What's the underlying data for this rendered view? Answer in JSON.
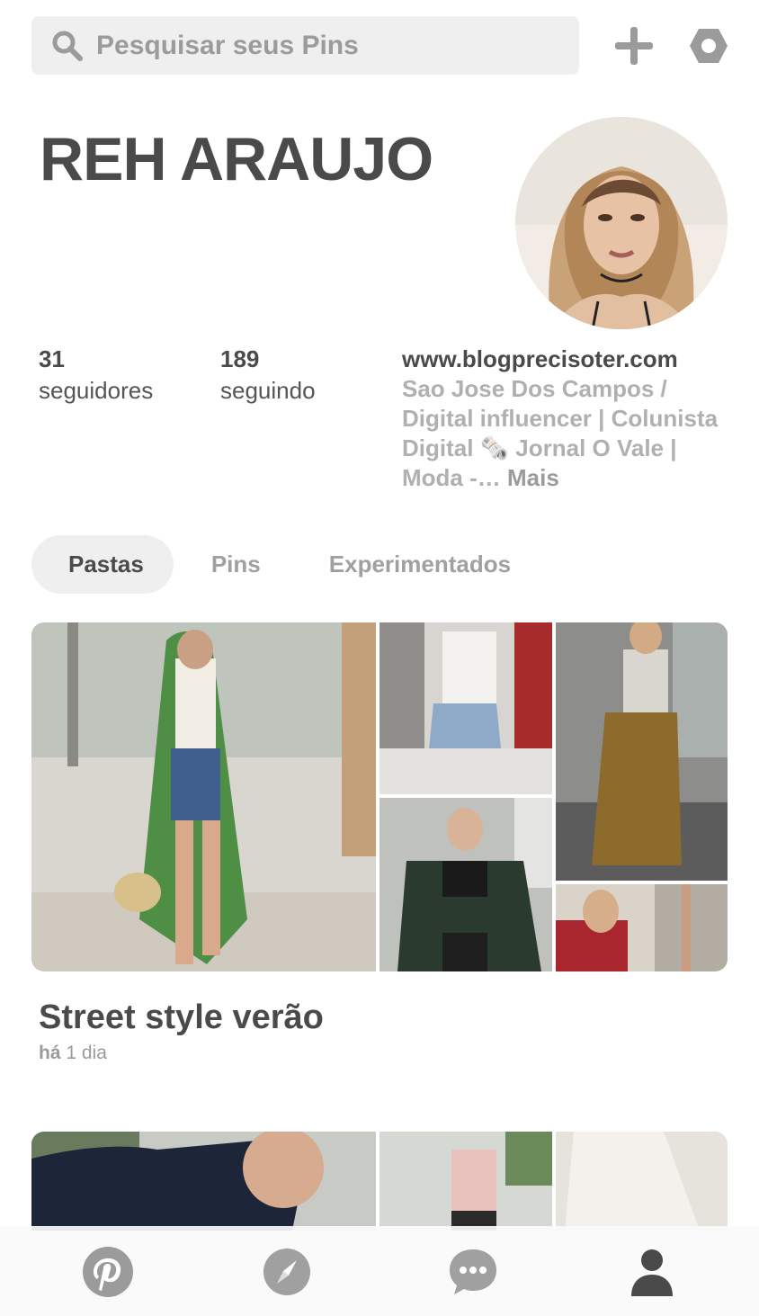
{
  "search": {
    "placeholder": "Pesquisar seus Pins"
  },
  "profile": {
    "name": "REH ARAUJO",
    "followers": {
      "count": "31",
      "label": "seguidores"
    },
    "following": {
      "count": "189",
      "label": "seguindo"
    },
    "website": "www.blogprecisoter.com",
    "bio": "Sao Jose Dos Campos  /  Digital influencer | Colunista Digital 🗞️ Jornal O Vale | Moda -…",
    "bio_more": "Mais"
  },
  "tabs": [
    {
      "label": "Pastas",
      "active": true
    },
    {
      "label": "Pins",
      "active": false
    },
    {
      "label": "Experimentados",
      "active": false
    }
  ],
  "boards": [
    {
      "title": "Street style verão",
      "updated_prefix": "há",
      "updated_value": "1 dia"
    },
    {
      "title": ""
    }
  ],
  "navbar": {
    "items": [
      "pinterest-home-icon",
      "explore-compass-icon",
      "messages-icon",
      "profile-icon"
    ],
    "active": "profile-icon"
  },
  "colors": {
    "text": "#4a4a4a",
    "muted": "#9b9b9b",
    "pill": "#efefef"
  }
}
